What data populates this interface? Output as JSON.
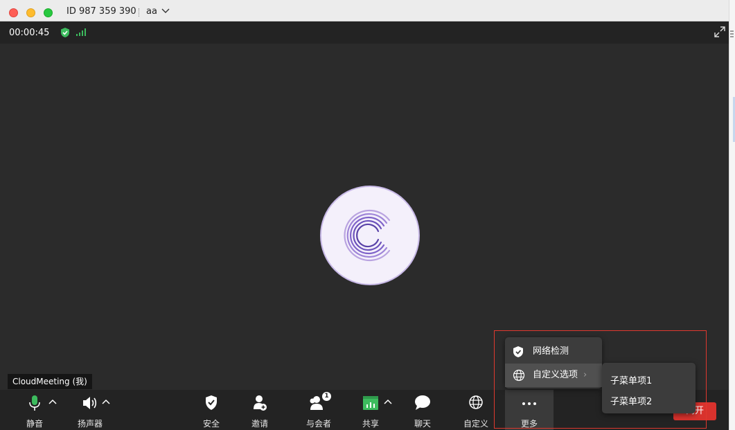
{
  "titlebar": {
    "meeting_id": "ID 987 359 390",
    "user_name": "aa"
  },
  "status": {
    "timer": "00:00:45"
  },
  "video": {
    "participant_name": "CloudMeeting (我)"
  },
  "controls": {
    "mute": "静音",
    "speaker": "扬声器",
    "security": "安全",
    "invite": "邀请",
    "participants": "与会者",
    "participants_badge": "1",
    "share": "共享",
    "chat": "聊天",
    "custom": "自定义",
    "more": "更多",
    "leave": "离开"
  },
  "more_menu": {
    "items": [
      {
        "label": "网络检测",
        "icon": "shield-check-icon"
      },
      {
        "label": "自定义选项",
        "icon": "globe-icon",
        "has_submenu": true
      }
    ]
  },
  "submenu": {
    "items": [
      {
        "label": "子菜单项1"
      },
      {
        "label": "子菜单项2"
      }
    ]
  },
  "colors": {
    "accent_green": "#3dbb5e",
    "leave_red": "#d8322d",
    "highlight_red": "#e0392f"
  }
}
